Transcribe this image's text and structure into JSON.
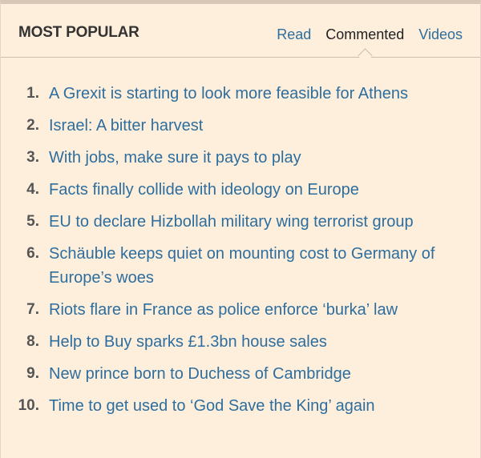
{
  "widget": {
    "title": "MOST POPULAR",
    "tabs": [
      {
        "label": "Read",
        "active": false
      },
      {
        "label": "Commented",
        "active": true
      },
      {
        "label": "Videos",
        "active": false
      }
    ]
  },
  "items": [
    {
      "num": "1.",
      "text": "A Grexit is starting to look more feasible for Athens"
    },
    {
      "num": "2.",
      "text": "Israel: A bitter harvest"
    },
    {
      "num": "3.",
      "text": "With jobs, make sure it pays to play"
    },
    {
      "num": "4.",
      "text": "Facts finally collide with ideology on Europe"
    },
    {
      "num": "5.",
      "text": "EU to declare Hizbollah military wing terrorist group"
    },
    {
      "num": "6.",
      "text": "Schäuble keeps quiet on mounting cost to Germany of Europe’s woes"
    },
    {
      "num": "7.",
      "text": "Riots flare in France as police enforce ‘burka’ law"
    },
    {
      "num": "8.",
      "text": "Help to Buy sparks £1.3bn house sales"
    },
    {
      "num": "9.",
      "text": "New prince born to Duchess of Cambridge"
    },
    {
      "num": "10.",
      "text": "Time to get used to ‘God Save the King’ again"
    }
  ],
  "colors": {
    "background": "#fdefdc",
    "link": "#2e6e9e",
    "title": "#333333",
    "number": "#555555"
  }
}
